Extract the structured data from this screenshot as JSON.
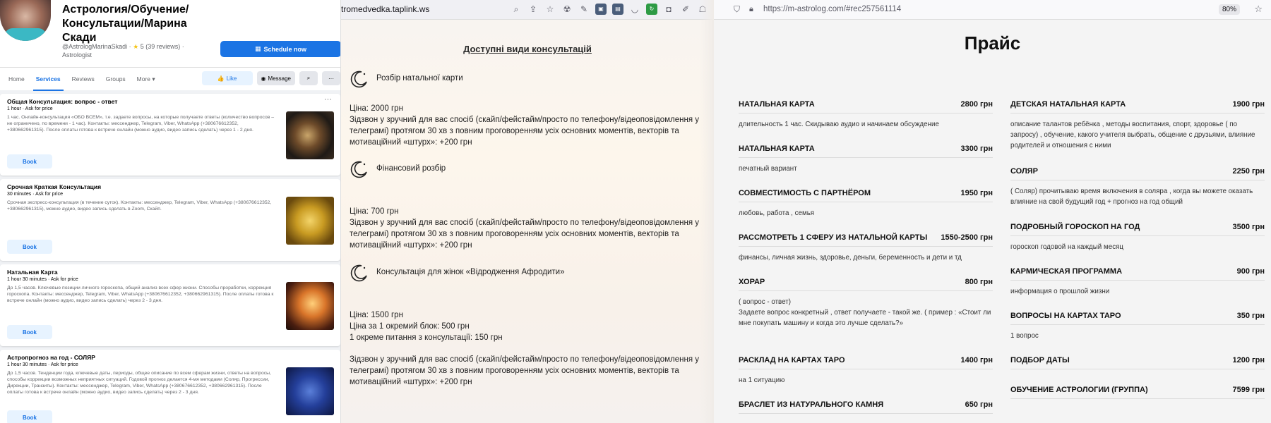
{
  "facebook": {
    "title": "Астрология/Обучение/Консультации/Марина Скади",
    "handle": "@AstrologMarinaSkadi · ",
    "rating": "5 (39 reviews) ·",
    "category": "Astrologist",
    "schedule_label": "Schedule now",
    "tabs": [
      "Home",
      "Services",
      "Reviews",
      "Groups",
      "More"
    ],
    "like_label": "Like",
    "message_label": "Message",
    "services": [
      {
        "title": "Общая Консультация: вопрос - ответ",
        "meta": "1 hour · Ask for price",
        "desc": "1 час. Онлайн-консультация «ОБО ВСЕМ», т.е. задаете вопросы, на которые получаете ответы (количество вопросов – не ограничено, по времени - 1 час). Контакты: мессенджер, Telegram, Viber, WhatsApp (+380676612352, +380662961315). После оплаты готова к встрече онлайн (можно аудио, видео запись сделать) через 1 - 2 дня.",
        "book": "Book"
      },
      {
        "title": "Срочная Краткая Консультация",
        "meta": "30 minutes · Ask for price",
        "desc": "Срочная экспресс-консультация (в течение суток). Контакты: мессенджер, Telegram, Viber, WhatsApp (+380676612352, +380662961315), можно аудио, видео запись сделать в Zoom, Скайп.",
        "book": "Book"
      },
      {
        "title": "Натальная Карта",
        "meta": "1 hour 30 minutes · Ask for price",
        "desc": "До 1,5 часов. Ключевые позиции личного гороскопа, общий анализ всех сфер жизни. Способы проработки, коррекция гороскопа. Контакты: мессенджер, Telegram, Viber, WhatsApp (+380676612352, +380662961315). После оплаты готова к встрече онлайн (можно аудио, видео запись сделать) через 2 - 3 дня.",
        "book": "Book"
      },
      {
        "title": "Астропрогноз на год - СОЛЯР",
        "meta": "1 hour 30 minutes · Ask for price",
        "desc": "До 1,5 часов. Тенденции года, ключевые даты, периоды, общее описание по всем сферам жизни, ответы на вопросы, способы коррекции возможных неприятных ситуаций. Годовой прогноз делается 4-мя методами (Соляр, Прогрессии, Дирекции, Транзиты). Контакты: мессенджер, Telegram, Viber, WhatsApp (+380676612352, +380662961315). После оплаты готова к встрече онлайн (можно аудио, видео запись сделать) через 2 - 3 дня.",
        "book": "Book"
      }
    ]
  },
  "taplink": {
    "url": "tromedvedka.taplink.ws",
    "heading": "Доступні види консультацій",
    "sections": [
      {
        "title": "Розбір натальної карти",
        "price": "Ціна: 2000 грн",
        "extra": "",
        "text": "Зідзвон у зручний для вас спосіб (скайп/фейстайм/просто по телефону/відеоповідомлення у телеграмі) протягом 30 хв з повним проговоренням усіх основних моментів, векторів та мотиваційний «штурх»: +200 грн"
      },
      {
        "title": "Фінансовий розбір",
        "price": "Ціна: 700 грн",
        "extra": "",
        "text": "Зідзвон у зручний для вас спосіб (скайп/фейстайм/просто по телефону/відеоповідомлення у телеграмі) протягом 30 хв з повним проговоренням усіх основних моментів, векторів та мотиваційний «штурх»: +200 грн"
      },
      {
        "title": "Консультація для жінок «Відродження Афродити»",
        "price": "Ціна: 1500 грн",
        "extra": "Ціна за 1 окремий блок: 500 грн",
        "extra2": "1 окреме питання з консультації: 150 грн",
        "text": "Зідзвон у зручний для вас спосіб (скайп/фейстайм/просто по телефону/відеоповідомлення у телеграмі) протягом 30 хв з повним проговоренням усіх основних моментів, векторів та мотиваційний «штурх»: +200 грн"
      }
    ]
  },
  "astrolog": {
    "url": "https://m-astrolog.com/#rec257561114",
    "zoom": "80%",
    "title": "Прайс",
    "left": [
      {
        "name": "НАТАЛЬНАЯ КАРТА",
        "price": "2800 грн",
        "desc": "длительность 1 час. Скидываю аудио и начинаем обсуждение"
      },
      {
        "name": "НАТАЛЬНАЯ КАРТА",
        "price": "3300 грн",
        "desc": "печатный вариант"
      },
      {
        "name": "СОВМЕСТИМОСТЬ С ПАРТНЁРОМ",
        "price": "1950 грн",
        "desc": "любовь, работа , семья"
      },
      {
        "name": "РАССМОТРЕТЬ 1 СФЕРУ ИЗ НАТАЛЬНОЙ КАРТЫ",
        "price": "1550-2500 грн",
        "desc": "финансы, личная жизнь, здоровье, деньги, беременность и дети и тд"
      },
      {
        "name": "ХОРАР",
        "price": "800 грн",
        "desc": "( вопрос - ответ)\nЗадаете вопрос конкретный , ответ получаете - такой же. ( пример : «Стоит ли мне покупать машину и когда это лучше сделать?»"
      },
      {
        "name": "РАСКЛАД НА КАРТАХ ТАРО",
        "price": "1400 грн",
        "desc": "на 1 ситуацию"
      },
      {
        "name": "БРАСЛЕТ ИЗ НАТУРАЛЬНОГО КАМНЯ",
        "price": "650 грн",
        "desc": ""
      }
    ],
    "right": [
      {
        "name": "ДЕТСКАЯ НАТАЛЬНАЯ КАРТА",
        "price": "1900 грн",
        "desc": "описание талантов ребёнка , методы воспитания, спорт, здоровье ( по запросу) , обучение, какого учителя выбрать, общение с друзьями, влияние родителей и отношения с ними"
      },
      {
        "name": "СОЛЯР",
        "price": "2250 грн",
        "desc": "( Соляр) прочитываю время включения в соляра , когда вы можете оказать влияние на свой будущий год + прогноз на год общий"
      },
      {
        "name": "ПОДРОБНЫЙ ГОРОСКОП НА ГОД",
        "price": "3500 грн",
        "desc": "гороскоп годовой на каждый месяц"
      },
      {
        "name": "КАРМИЧЕСКАЯ ПРОГРАММА",
        "price": "900 грн",
        "desc": "информация о прошлой жизни"
      },
      {
        "name": "ВОПРОСЫ НА КАРТАХ ТАРО",
        "price": "350 грн",
        "desc": "1 вопрос"
      },
      {
        "name": "ПОДБОР ДАТЫ",
        "price": "1200 грн",
        "desc": ""
      },
      {
        "name": "ОБУЧЕНИЕ АСТРОЛОГИИ (ГРУППА)",
        "price": "7599 грн",
        "desc": ""
      }
    ]
  }
}
